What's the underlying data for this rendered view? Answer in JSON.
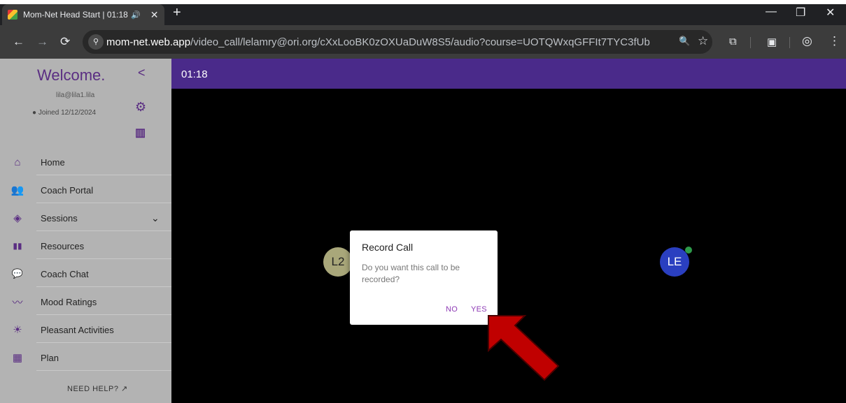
{
  "browser": {
    "tab_title": "Mom-Net Head Start | 01:18",
    "tab_audio": "🔊",
    "tab_close": "✕",
    "new_tab": "+",
    "win_min": "—",
    "win_max": "❐",
    "win_close": "✕",
    "nav_back": "←",
    "nav_forward": "→",
    "nav_reload": "⟳",
    "url_site_icon": "⚲",
    "url_host": "mom-net.web.app",
    "url_path": "/video_call/lelamry@ori.org/cXxLooBK0zOXUaDuW8S5/audio?course=UOTQWxqGFFIt7TYC3fUb",
    "zoom_icon": "🔍",
    "star_icon": "☆",
    "ext_icon": "⧉",
    "sidepanel_icon": "▣",
    "profile_icon": "◎",
    "menu_icon": "⋮"
  },
  "sidebar": {
    "welcome": "Welcome.",
    "collapse": "<",
    "email": "lila@lila1.lila",
    "joined": "Joined 12/12/2024",
    "joined_icon": "●",
    "settings_icon": "⚙",
    "library_icon": "▥",
    "items": [
      {
        "label": "Home",
        "icon": "⌂"
      },
      {
        "label": "Coach Portal",
        "icon": "👥"
      },
      {
        "label": "Sessions",
        "icon": "◈",
        "chevron": "⌄"
      },
      {
        "label": "Resources",
        "icon": "▮▮"
      },
      {
        "label": "Coach Chat",
        "icon": "💬"
      },
      {
        "label": "Mood Ratings",
        "icon": "〰"
      },
      {
        "label": "Pleasant Activities",
        "icon": "☀"
      },
      {
        "label": "Plan",
        "icon": "▦"
      }
    ],
    "need_help": "NEED HELP? ↗"
  },
  "call": {
    "timer": "01:18",
    "participants": [
      {
        "initials": "L2"
      },
      {
        "initials": "LE"
      }
    ]
  },
  "dialog": {
    "title": "Record Call",
    "message": "Do you want this call to be recorded?",
    "no": "NO",
    "yes": "YES"
  },
  "colors": {
    "accent": "#4a2a8a",
    "sidebar_bg": "#b3b3b3",
    "annotation_arrow": "#c00000"
  }
}
